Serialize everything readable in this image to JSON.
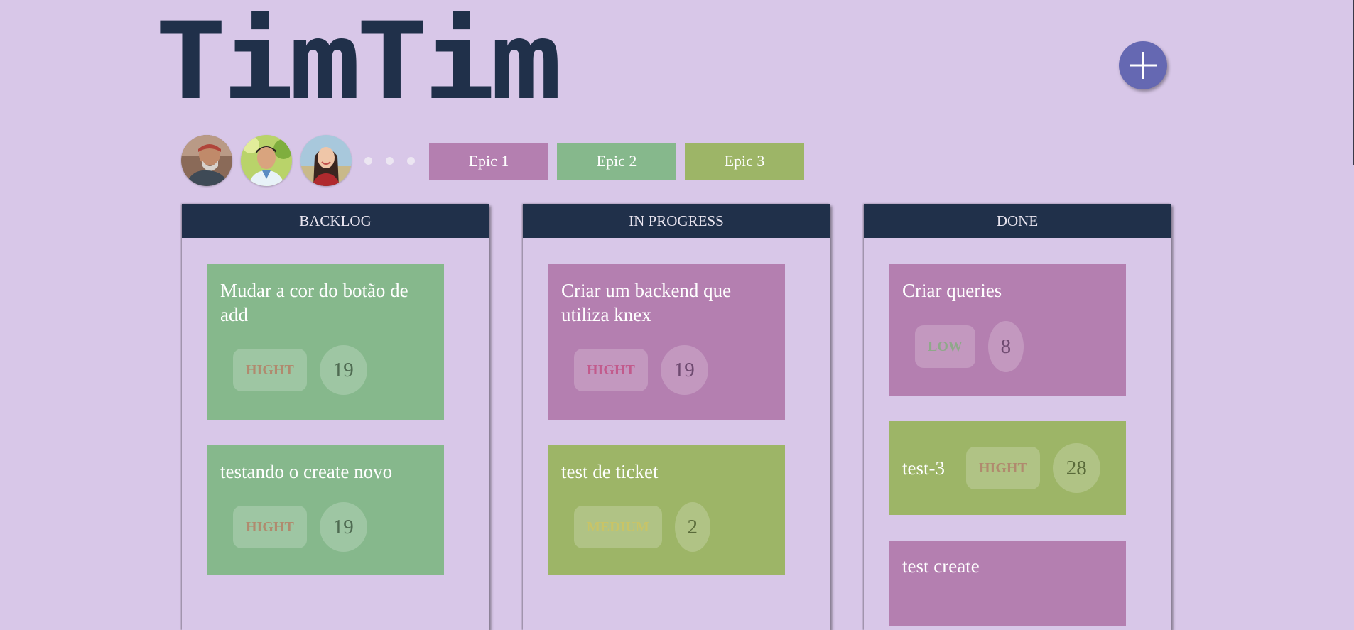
{
  "app": {
    "logo_text": "TimTim",
    "add_button_icon": "plus-icon"
  },
  "colors": {
    "background": "#d8c7e8",
    "navy": "#20304a",
    "purple": "#b47fb0",
    "green": "#86b88c",
    "olive": "#9db567",
    "add_button": "#6568b2"
  },
  "members": [
    {
      "name": "member-1"
    },
    {
      "name": "member-2"
    },
    {
      "name": "member-3"
    }
  ],
  "epics": [
    {
      "label": "Epic 1",
      "color": "#b47fb0"
    },
    {
      "label": "Epic 2",
      "color": "#86b88c"
    },
    {
      "label": "Epic 3",
      "color": "#9db567"
    }
  ],
  "columns": [
    {
      "title": "BACKLOG",
      "cards": [
        {
          "title": "Mudar a cor do botão de add",
          "priority": "HIGHT",
          "points": "19",
          "color": "#86b88c",
          "priority_color": "#b08a6e",
          "points_color": "#4f6b52"
        },
        {
          "title": "testando o create novo",
          "priority": "HIGHT",
          "points": "19",
          "color": "#86b88c",
          "priority_color": "#b08a6e",
          "points_color": "#4f6b52"
        }
      ]
    },
    {
      "title": "IN PROGRESS",
      "cards": [
        {
          "title": "Criar um backend que utiliza knex",
          "priority": "HIGHT",
          "points": "19",
          "color": "#b47fb0",
          "priority_color": "#c25a8c",
          "points_color": "#6e4a70"
        },
        {
          "title": "test de ticket",
          "priority": "MEDIUM",
          "points": "2",
          "color": "#9db567",
          "priority_color": "#c9c466",
          "points_color": "#5a6b3a"
        }
      ]
    },
    {
      "title": "DONE",
      "cards": [
        {
          "title": "Criar queries",
          "priority": "LOW",
          "points": "8",
          "color": "#b47fb0",
          "priority_color": "#8fa88a",
          "points_color": "#6e4a70"
        },
        {
          "title": "test-3",
          "priority": "HIGHT",
          "points": "28",
          "color": "#9db567",
          "priority_color": "#b08a6e",
          "points_color": "#5a6b3a"
        },
        {
          "title": "test create",
          "priority": "",
          "points": "",
          "color": "#b47fb0",
          "priority_color": "#b08a6e",
          "points_color": "#6e4a70"
        }
      ]
    }
  ]
}
